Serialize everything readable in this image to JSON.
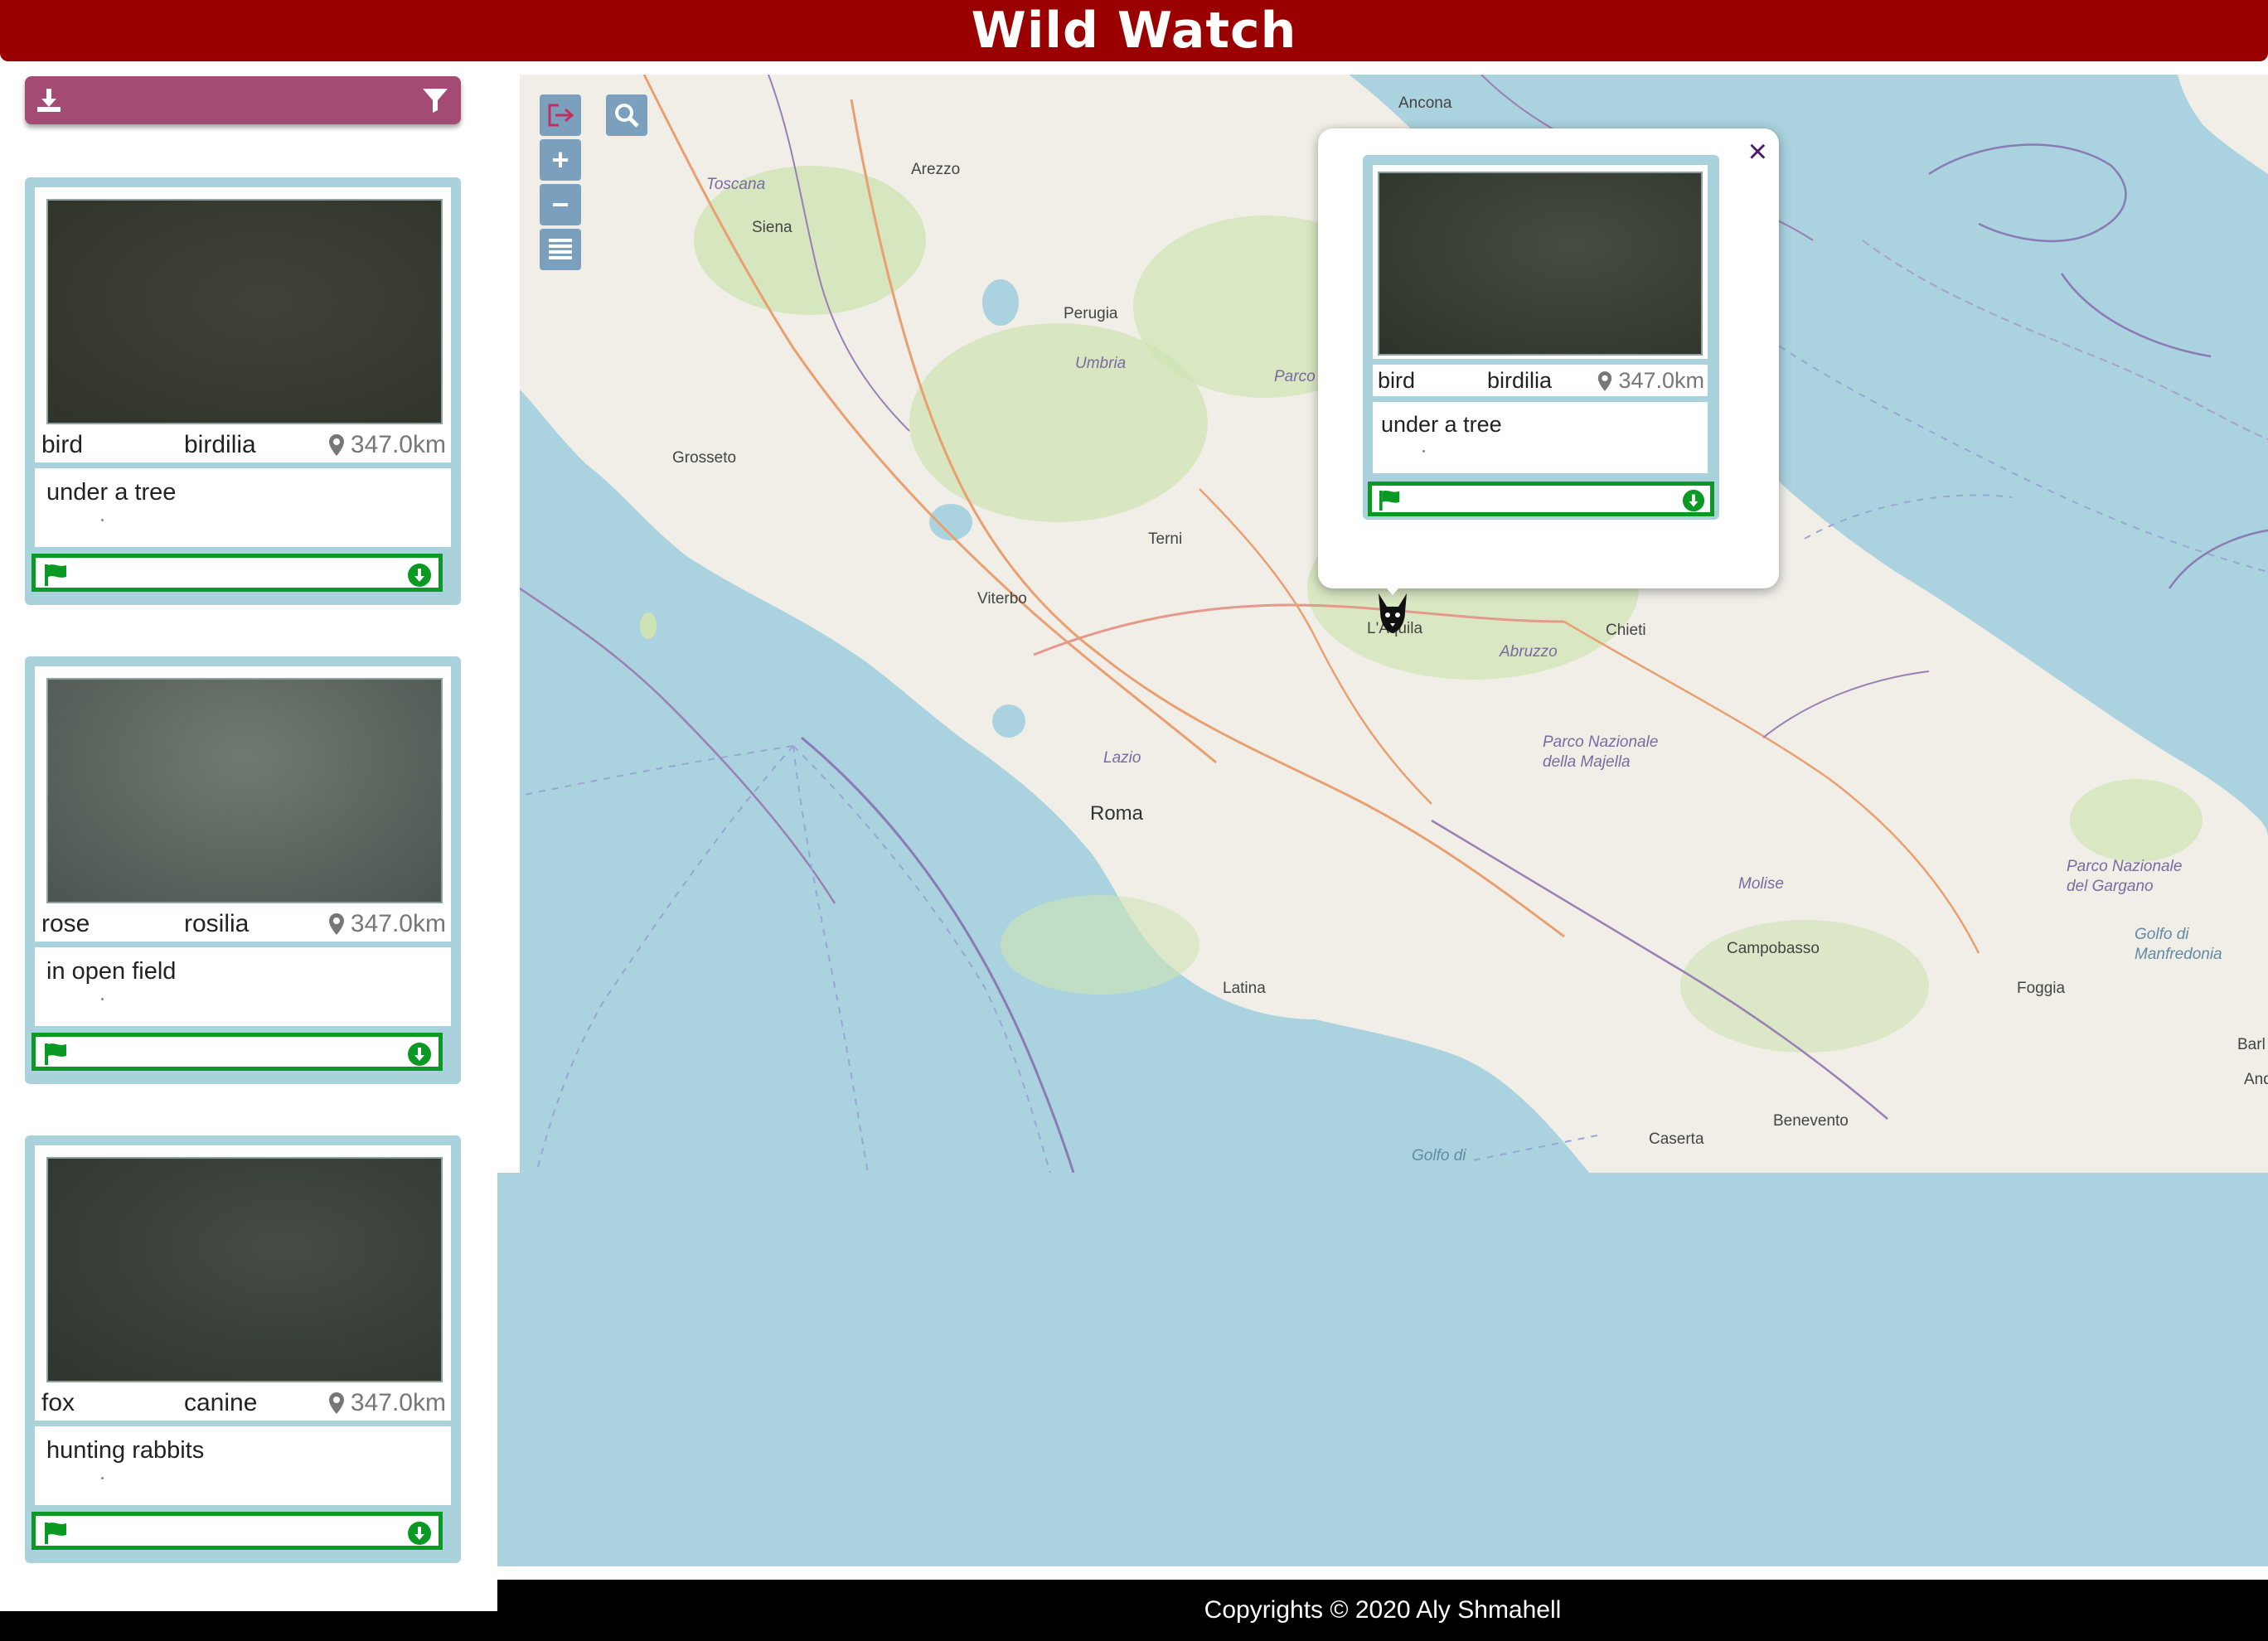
{
  "header": {
    "title": "Wild Watch"
  },
  "toolbar": {
    "download_icon": "download-icon",
    "filter_icon": "filter-icon"
  },
  "sightings": [
    {
      "name": "bird",
      "species": "birdilia",
      "distance": "347.0km",
      "description": "under a tree",
      "photo_gradient": [
        "#3a3d33",
        "#2e3329"
      ]
    },
    {
      "name": "rose",
      "species": "rosilia",
      "distance": "347.0km",
      "description": "in open field",
      "photo_gradient": [
        "#6c776c",
        "#4e5650"
      ]
    },
    {
      "name": "fox",
      "species": "canine",
      "distance": "347.0km",
      "description": "hunting rabbits",
      "photo_gradient": [
        "#424a42",
        "#2f342c"
      ]
    }
  ],
  "popup": {
    "name": "bird",
    "species": "birdilia",
    "distance": "347.0km",
    "description": "under a tree",
    "close": "×"
  },
  "map": {
    "controls": {
      "zoom_in": "+",
      "zoom_out": "−"
    },
    "labels": {
      "ancona": "Ancona",
      "arezzo": "Arezzo",
      "toscana": "Toscana",
      "siena": "Siena",
      "perugia": "Perugia",
      "umbria": "Umbria",
      "grosseto": "Grosseto",
      "terni": "Terni",
      "viterbo": "Viterbo",
      "chieti": "Chieti",
      "abruzzo": "Abruzzo",
      "parco_majella": "Parco Nazionale della Majella",
      "lazio": "Lazio",
      "roma": "Roma",
      "molise": "Molise",
      "campobasso": "Campobasso",
      "foggia": "Foggia",
      "parco_gargano": "Parco Nazionale del Gargano",
      "golfo_manfredonia": "Golfo di Manfredonia",
      "latina": "Latina",
      "benevento": "Benevento",
      "caserta": "Caserta",
      "golfo_di": "Golfo di",
      "laquila": "L'Aquila",
      "parco_short": "Parco",
      "bar": "Barl",
      "and": "And"
    },
    "colors": {
      "sea": "#aad3df",
      "land": "#f1eee8",
      "forest": "#cfe4b4"
    }
  },
  "footer": {
    "text": "Copyrights © 2020 Aly Shmahell"
  }
}
